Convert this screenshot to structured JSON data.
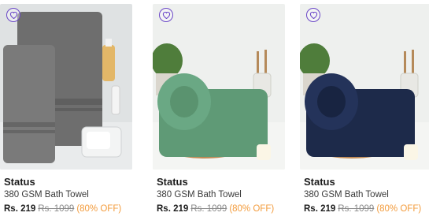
{
  "products": [
    {
      "brand": "Status",
      "name": "380 GSM Bath Towel",
      "price": "Rs. 219",
      "mrp": "Rs. 1099",
      "discount": "(80% OFF)",
      "towel_color": "#707070",
      "image": "grey-towel-bath-accessories"
    },
    {
      "brand": "Status",
      "name": "380 GSM Bath Towel",
      "price": "Rs. 219",
      "mrp": "Rs. 1099",
      "discount": "(80% OFF)",
      "towel_color": "#5f9a76",
      "image": "green-rolled-towel"
    },
    {
      "brand": "Status",
      "name": "380 GSM Bath Towel",
      "price": "Rs. 219",
      "mrp": "Rs. 1099",
      "discount": "(80% OFF)",
      "towel_color": "#1d2a4a",
      "image": "navy-rolled-towel"
    }
  ],
  "colors": {
    "wishlist": "#6b48c8",
    "discount": "#f39c3d",
    "strike": "#8a8a8a"
  },
  "icons": {
    "wishlist": "heart-outline-icon"
  }
}
